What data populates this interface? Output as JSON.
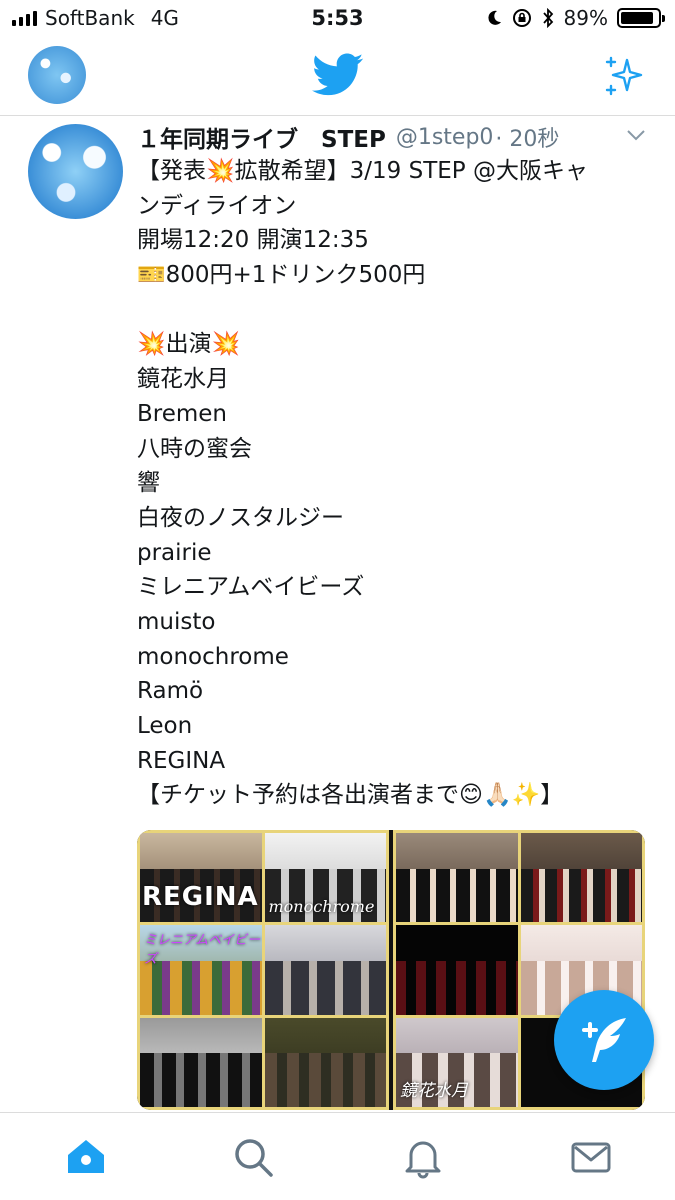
{
  "status_bar": {
    "carrier": "SoftBank",
    "network": "4G",
    "time": "5:53",
    "battery_percent": "89%",
    "battery_level": 0.89
  },
  "header": {
    "logo_icon": "twitter-bird-icon",
    "sparkle_icon": "sparkle-icon"
  },
  "tweet": {
    "name": "１年同期ライブ　STEP",
    "handle": "@1step0",
    "time": "· 20秒",
    "lines": [
      "【発表💥拡散希望】3/19 STEP @大阪キャ",
      "ンディライオン",
      "開場12:20 開演12:35",
      "🎫800円+1ドリンク500円",
      "",
      "💥出演💥",
      "鏡花水月",
      "Bremen",
      "八時の蜜会",
      "響",
      "白夜のノスタルジー",
      "prairie",
      "ミレニアムベイビーズ",
      "muisto",
      "monochrome",
      "Ramö",
      "Leon",
      "REGINA",
      "【チケット予約は各出演者まで😊🙏🏻✨】"
    ],
    "media": {
      "left_labels": [
        "REGINA",
        "monochrome",
        "ミレニアムベイビーズ",
        "",
        "",
        ""
      ],
      "right_labels": [
        "",
        "",
        "",
        "",
        "鏡花水月",
        ""
      ]
    }
  },
  "colors": {
    "brand": "#1da1f2",
    "text": "#14171a",
    "secondary": "#657786",
    "collage_border": "#e8d47a"
  },
  "tabs": [
    "home-icon",
    "search-icon",
    "notifications-icon",
    "messages-icon"
  ]
}
